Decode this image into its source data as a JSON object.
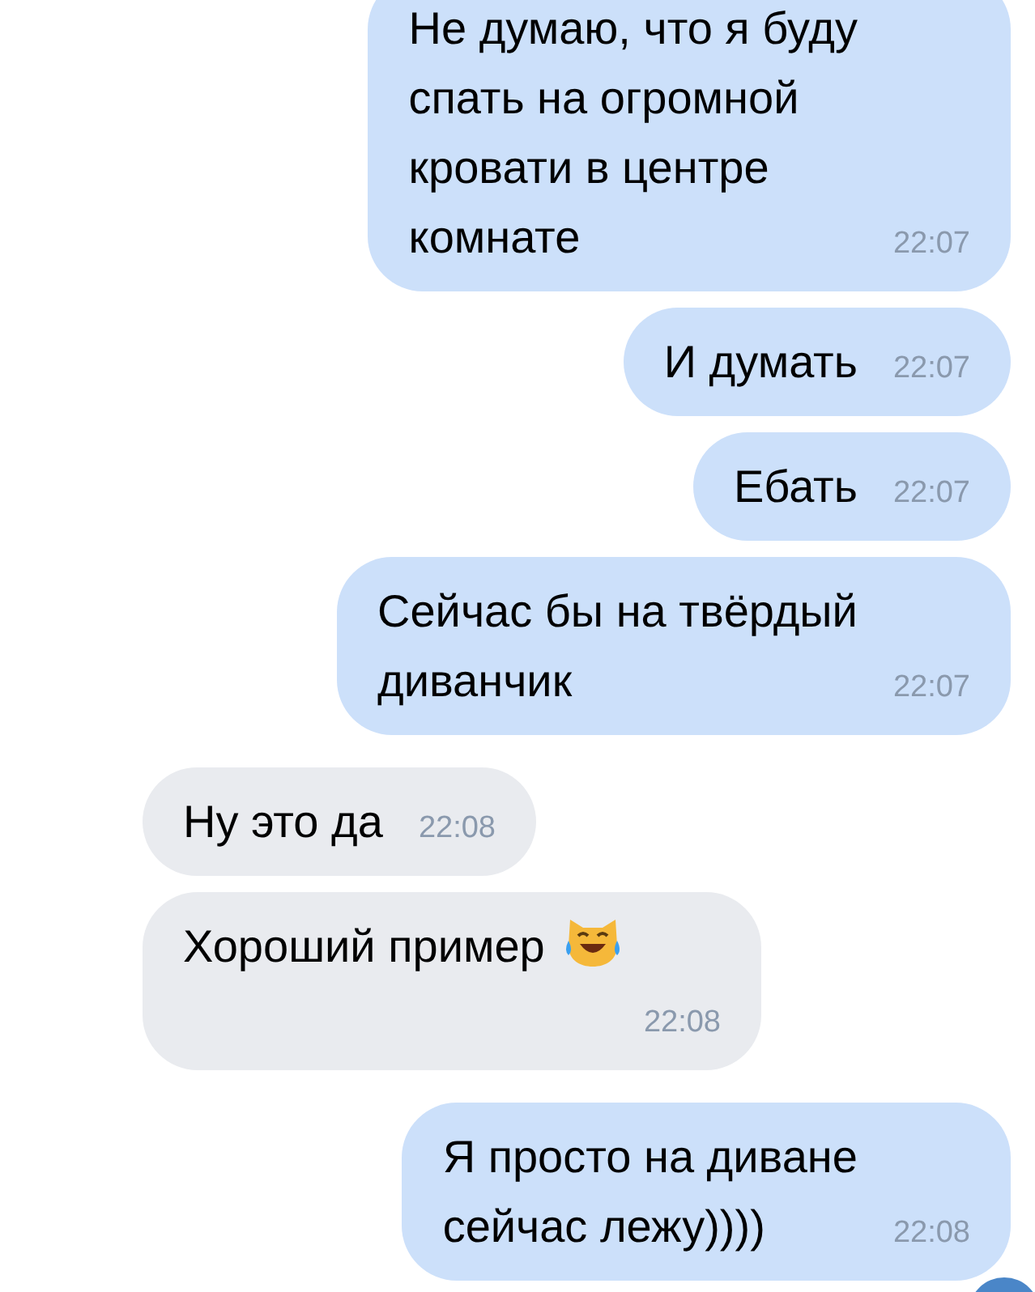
{
  "messages": [
    {
      "kind": "outgoing",
      "text": "Не думаю, что я буду\nспать на огромной\nкровати в центре\nкомнате",
      "time": "22:07"
    },
    {
      "kind": "outgoing",
      "text": "И думать",
      "time": "22:07"
    },
    {
      "kind": "outgoing",
      "text": "Ебать",
      "time": "22:07"
    },
    {
      "kind": "outgoing",
      "text": "Сейчас бы на твёрдый\nдиванчик",
      "time": "22:07"
    },
    {
      "kind": "incoming",
      "text": "Ну это да",
      "time": "22:08"
    },
    {
      "kind": "incoming",
      "text": "Хороший пример",
      "emoji": true,
      "time": "22:08"
    },
    {
      "kind": "outgoing",
      "text": "Я просто на диване\nсейчас лежу))))",
      "time": "22:08"
    }
  ]
}
